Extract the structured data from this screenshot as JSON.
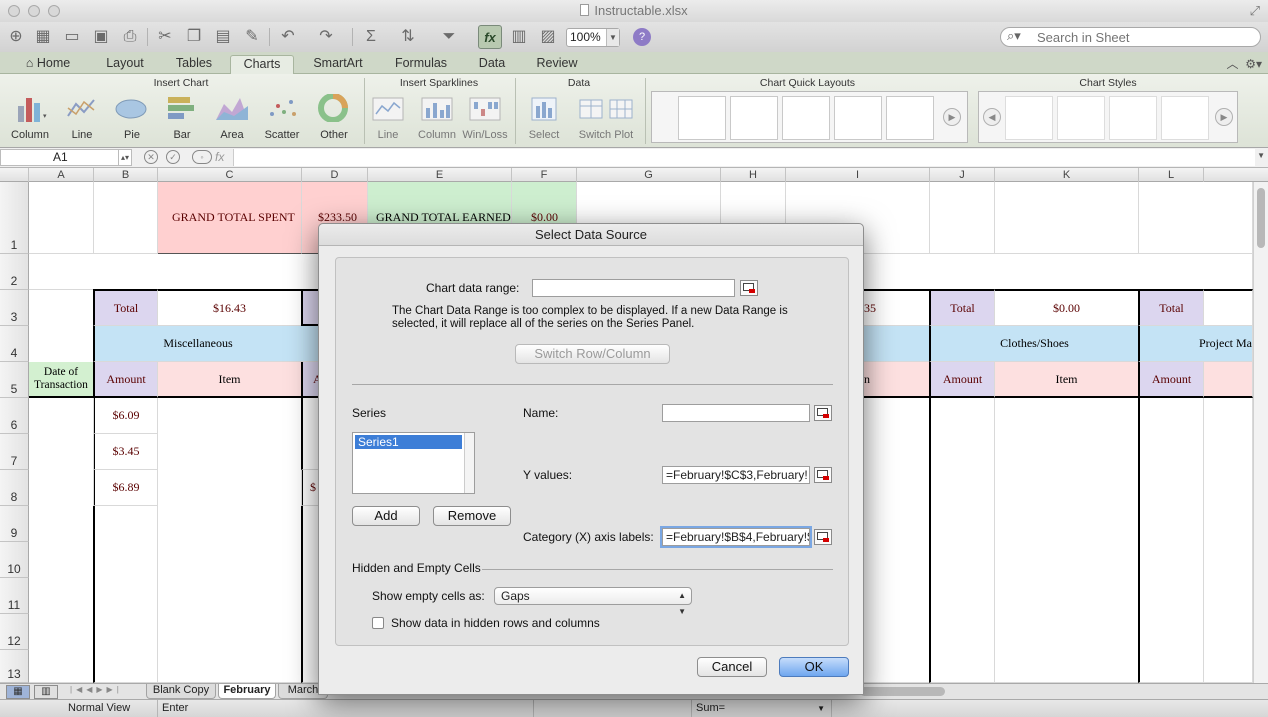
{
  "window": {
    "title": "Instructable.xlsx"
  },
  "toolbar": {
    "zoom": "100%",
    "search_placeholder": "Search in Sheet",
    "fx_label": "fx",
    "help_label": "?"
  },
  "ribbon": {
    "tabs": [
      "Home",
      "Layout",
      "Tables",
      "Charts",
      "SmartArt",
      "Formulas",
      "Data",
      "Review"
    ],
    "active_tab": "Charts",
    "groups": {
      "insert_chart": "Insert Chart",
      "insert_sparklines": "Insert Sparklines",
      "data": "Data",
      "quick_layouts": "Chart Quick Layouts",
      "chart_styles": "Chart Styles"
    },
    "insert_chart": [
      "Column",
      "Line",
      "Pie",
      "Bar",
      "Area",
      "Scatter",
      "Other"
    ],
    "sparklines": [
      "Line",
      "Column",
      "Win/Loss"
    ],
    "data_buttons": [
      "Select",
      "Switch Plot"
    ]
  },
  "formula_bar": {
    "cell_ref": "A1",
    "fx": "fx"
  },
  "grid": {
    "columns": [
      "A",
      "B",
      "C",
      "D",
      "E",
      "F",
      "G",
      "H",
      "I",
      "J",
      "K",
      "L"
    ],
    "rows": [
      "1",
      "2",
      "3",
      "4",
      "5",
      "6",
      "7",
      "8",
      "9",
      "10",
      "11",
      "12",
      "13"
    ],
    "cells": {
      "grand_total_spent_label": "GRAND TOTAL SPENT",
      "grand_total_spent_value": "$233.50",
      "grand_total_earned_label": "GRAND TOTAL EARNED",
      "grand_total_earned_value": "$0.00",
      "total_label_b": "Total",
      "total_value_c": "$16.43",
      "misc_header": "Miscellaneous",
      "date_header": "Date of Transaction",
      "amount_header_b": "Amount",
      "item_header_c": "Item",
      "d5_partial": "A",
      "b6": "$6.09",
      "b7": "$3.45",
      "b8": "$6.89",
      "d8_partial": "$",
      "i3_partial": "35",
      "i5_partial": "n",
      "total_label_j": "Total",
      "total_value_k": "$0.00",
      "clothes_header": "Clothes/Shoes",
      "amount_header_j": "Amount",
      "item_header_k": "Item",
      "total_label_l": "Total",
      "project_header": "Project Ma",
      "amount_header_l": "Amount"
    }
  },
  "sheets": {
    "tabs": [
      "Blank Copy",
      "February",
      "March"
    ],
    "active": "February"
  },
  "status_bar": {
    "view": "Normal View",
    "mode": "Enter",
    "sum": "Sum="
  },
  "dialog": {
    "title": "Select Data Source",
    "chart_data_range_label": "Chart data range:",
    "chart_data_range_value": "",
    "complex_message": "The Chart Data Range is too complex to be displayed. If a new Data Range is selected, it will replace all of the series on the Series Panel.",
    "switch_label": "Switch Row/Column",
    "series_label": "Series",
    "series_items": [
      "Series1"
    ],
    "name_label": "Name:",
    "name_value": "",
    "y_values_label": "Y values:",
    "y_values_value": "=February!$C$3,February!",
    "category_label": "Category (X) axis labels:",
    "category_value": "=February!$B$4,February!$",
    "add_label": "Add",
    "remove_label": "Remove",
    "hidden_empty_label": "Hidden and Empty Cells",
    "show_empty_label": "Show empty cells as:",
    "show_empty_value": "Gaps",
    "show_hidden_label": "Show data in hidden rows and columns",
    "show_hidden_checked": false,
    "cancel_label": "Cancel",
    "ok_label": "OK"
  },
  "colors": {
    "accent": "#6fa6ef",
    "ribbon": "#dde3d7",
    "grand_spent": "#ffd0d0",
    "grand_earned": "#cdeecf"
  }
}
